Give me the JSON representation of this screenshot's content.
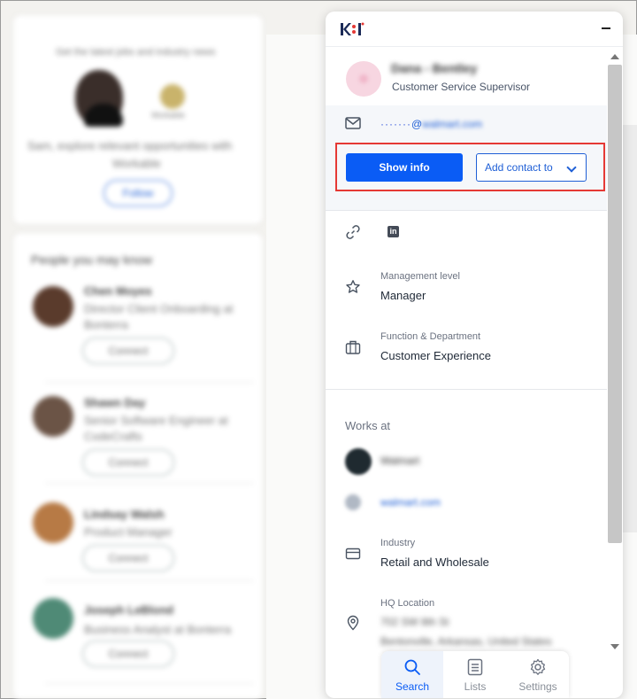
{
  "background": {
    "card1": {
      "hint_text": "Get the latest jobs and industry news",
      "company_name": "Workable",
      "blurb_line1": "Sam, explore relevant opportunities with",
      "blurb_line2": "Workable",
      "follow_label": "Follow"
    },
    "people_title": "People you may know",
    "people": [
      {
        "name": "Chen Moyes",
        "line1": "Director Client Onboarding at",
        "line2": "Bonterra",
        "button": "Connect"
      },
      {
        "name": "Shawn Day",
        "line1": "Senior Software Engineer at",
        "line2": "CodeCrafts",
        "button": "Connect"
      },
      {
        "name": "Lindsay Walsh",
        "line1": "Product Manager",
        "line2": "",
        "button": "Connect"
      },
      {
        "name": "Joseph LeBlond",
        "line1": "Business Analyst at Bonterra",
        "line2": "",
        "button": "Connect"
      }
    ]
  },
  "panel": {
    "contact": {
      "name": "Dana - Bentley",
      "title": "Customer Service Supervisor",
      "email_dots": "·······",
      "email_at": "@",
      "email_domain": "walmart.com"
    },
    "buttons": {
      "show_info": "Show info",
      "add_contact": "Add contact to"
    },
    "linkedin_label": "in",
    "fields": {
      "management_level_label": "Management level",
      "management_level_value": "Manager",
      "function_label": "Function & Department",
      "function_value": "Customer Experience"
    },
    "works_at": {
      "label": "Works at",
      "company": "Walmart",
      "website": "walmart.com",
      "industry_label": "Industry",
      "industry_value": "Retail and Wholesale",
      "hq_label": "HQ Location",
      "hq_line1": "702 SW 8th St",
      "hq_line2": "Bentonville, Arkansas, United States"
    },
    "nav": [
      {
        "label": "Search",
        "icon": "search-icon",
        "active": true
      },
      {
        "label": "Lists",
        "icon": "list-icon",
        "active": false
      },
      {
        "label": "Settings",
        "icon": "gear-icon",
        "active": false
      }
    ]
  },
  "colors": {
    "accent": "#0a5cf5",
    "highlight": "#e53935"
  }
}
